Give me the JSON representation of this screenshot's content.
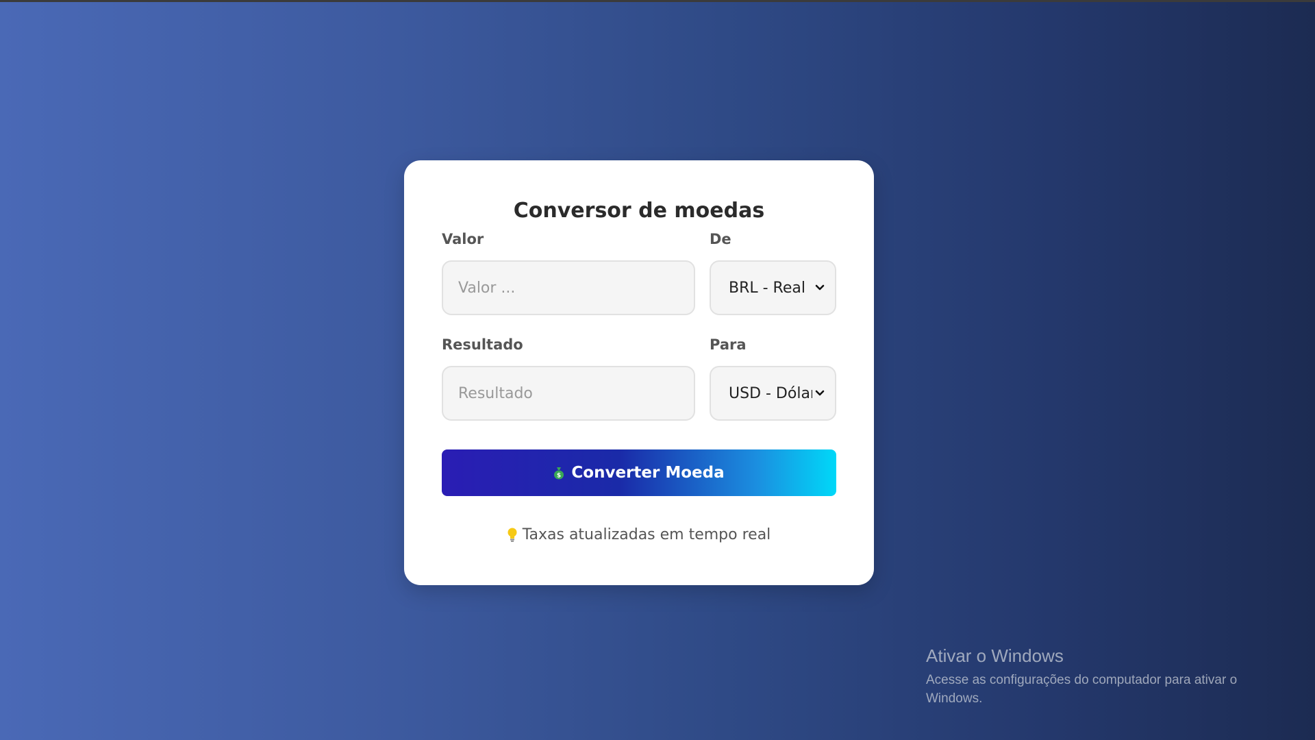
{
  "converter": {
    "title": "Conversor de moedas",
    "amount": {
      "label": "Valor",
      "placeholder": "Valor ...",
      "value": ""
    },
    "from": {
      "label": "De",
      "selected": "BRL - Real"
    },
    "result": {
      "label": "Resultado",
      "placeholder": "Resultado",
      "value": ""
    },
    "to": {
      "label": "Para",
      "selected": "USD - Dólar"
    },
    "convert_button": {
      "icon": "money-bag-icon",
      "label": "Converter Moeda"
    },
    "footer_note": {
      "icon": "lightbulb-icon",
      "text": "Taxas atualizadas em tempo real"
    },
    "colors": {
      "button_start": "#2a1db4",
      "button_end": "#00d8f8",
      "background_left": "#4a69b6",
      "background_right": "#1c2b52"
    }
  },
  "windows_watermark": {
    "title": "Ativar o Windows",
    "subtitle": "Acesse as configurações do computador para ativar o Windows."
  }
}
